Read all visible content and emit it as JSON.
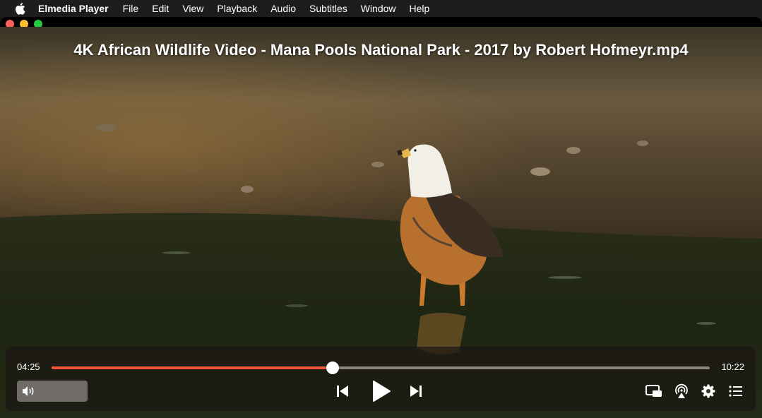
{
  "menubar": {
    "apple_icon": "apple-logo-icon",
    "app_name": "Elmedia Player",
    "items": [
      "File",
      "Edit",
      "View",
      "Playback",
      "Audio",
      "Subtitles",
      "Window",
      "Help"
    ]
  },
  "window": {
    "traffic_lights": [
      "close",
      "minimize",
      "zoom"
    ]
  },
  "video": {
    "title": "4K African Wildlife Video - Mana Pools National Park - 2017 by Robert Hofmeyr.mp4"
  },
  "playback": {
    "current_time": "04:25",
    "total_time": "10:22",
    "progress": 0.427,
    "accent_color": "#f0543b"
  },
  "controls": {
    "volume_icon": "speaker-volume-icon",
    "prev_icon": "skip-previous-icon",
    "play_icon": "play-icon",
    "next_icon": "skip-next-icon",
    "pip_icon": "picture-in-picture-icon",
    "airplay_icon": "airplay-icon",
    "settings_icon": "gear-icon",
    "playlist_icon": "playlist-icon"
  }
}
